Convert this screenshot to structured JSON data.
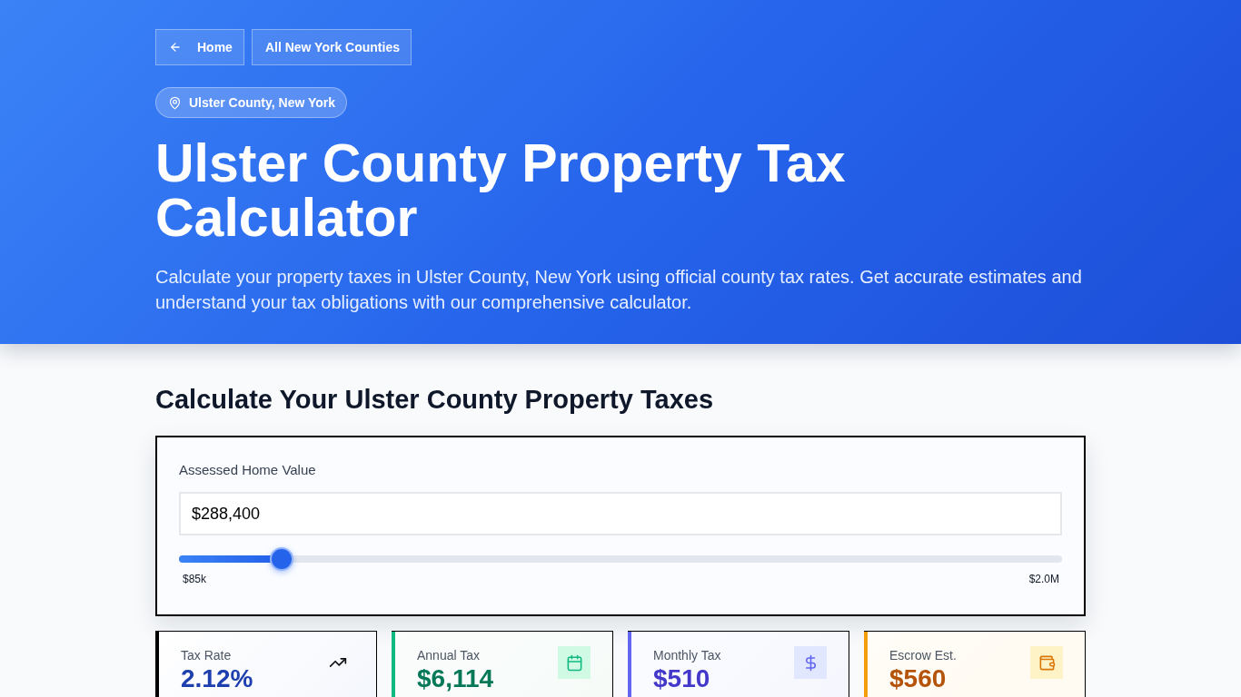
{
  "nav": [
    {
      "kind": "back",
      "label": "Home"
    },
    {
      "kind": "link",
      "label": "All New York Counties"
    }
  ],
  "location_badge": "Ulster County, New York",
  "hero": {
    "title": "Ulster County Property Tax Calculator",
    "description": "Calculate your property taxes in Ulster County, New York using official county tax rates. Get accurate estimates and understand your tax obligations with our comprehensive calculator."
  },
  "calculator": {
    "heading": "Calculate Your Ulster County Property Taxes",
    "field": {
      "label": "Assessed Home Value",
      "value": "$288,400"
    },
    "slider": {
      "level": 0.106,
      "min_label": "$85k",
      "max_label": "$2.0M"
    }
  },
  "stats": [
    {
      "kind": "rate",
      "label": "Tax Rate",
      "value": "2.12%",
      "color": "#000000"
    },
    {
      "kind": "annual",
      "label": "Annual Tax",
      "value": "$6,114",
      "color": "#10b981"
    },
    {
      "kind": "monthly",
      "label": "Monthly Tax",
      "value": "$510",
      "color": "#6366f1"
    },
    {
      "kind": "escrow",
      "label": "Escrow Est.",
      "value": "$560",
      "color": "#f59e0b"
    }
  ]
}
